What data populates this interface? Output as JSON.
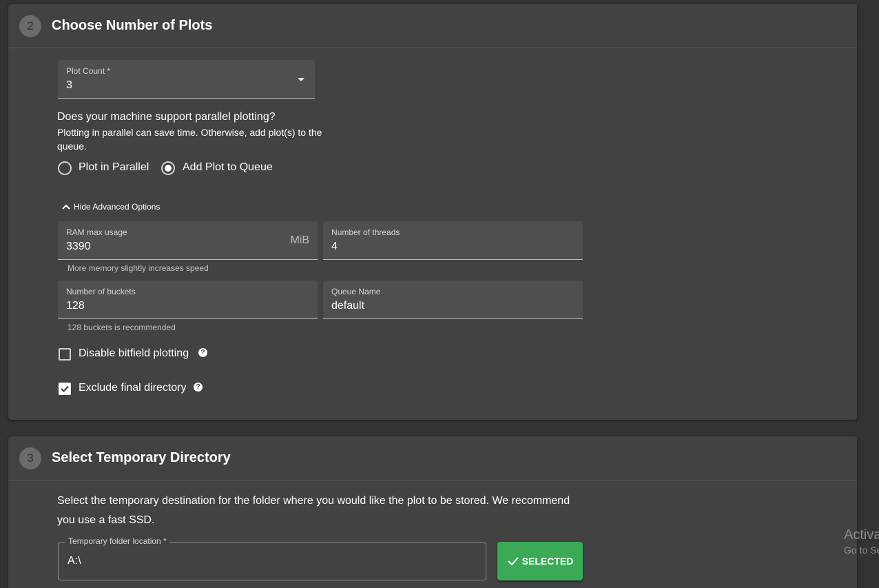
{
  "section2": {
    "step": "2",
    "title": "Choose Number of Plots",
    "plot_count": {
      "label": "Plot Count *",
      "value": "3"
    },
    "parallel": {
      "question": "Does your machine support parallel plotting?",
      "description": "Plotting in parallel can save time. Otherwise, add plot(s) to the queue.",
      "options": [
        {
          "label": "Plot in Parallel",
          "selected": false
        },
        {
          "label": "Add Plot to Queue",
          "selected": true
        }
      ]
    },
    "advanced_toggle": "Hide Advanced Options",
    "ram": {
      "label": "RAM max usage",
      "value": "3390",
      "unit": "MiB",
      "helper": "More memory slightly increases speed"
    },
    "threads": {
      "label": "Number of threads",
      "value": "4"
    },
    "buckets": {
      "label": "Number of buckets",
      "value": "128",
      "helper": "128 buckets is recommended"
    },
    "queue": {
      "label": "Queue Name",
      "value": "default"
    },
    "disable_bitfield": {
      "label": "Disable bitfield plotting",
      "checked": false
    },
    "exclude_final": {
      "label": "Exclude final directory",
      "checked": true
    },
    "help_glyph": "?"
  },
  "section3": {
    "step": "3",
    "title": "Select Temporary Directory",
    "description": "Select the temporary destination for the folder where you would like the plot to be stored. We recommend you use a fast SSD.",
    "temp_folder": {
      "label": "Temporary folder location *",
      "value": "A:\\"
    },
    "button_label": "SELECTED"
  },
  "watermark": {
    "line1": "Activa",
    "line2": "Go to Se"
  },
  "colors": {
    "background": "#333333",
    "card": "#424242",
    "field": "#4f4f4f",
    "success": "#3aaa57"
  }
}
